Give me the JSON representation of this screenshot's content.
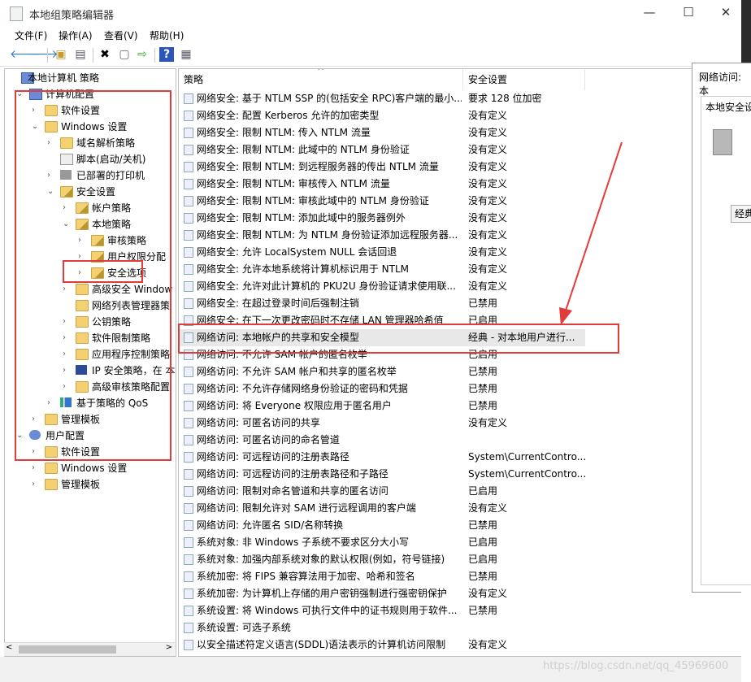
{
  "window": {
    "title": "本地组策略编辑器",
    "minimize": "—",
    "maximize": "☐",
    "close": "✕"
  },
  "menu": [
    "文件(F)",
    "操作(A)",
    "查看(V)",
    "帮助(H)"
  ],
  "tree": [
    {
      "label": "本地计算机 策略",
      "level": 0,
      "arrow": "",
      "icon": "computer-icon"
    },
    {
      "label": "计算机配置",
      "level": 1,
      "arrow": "v",
      "icon": "computer-icon"
    },
    {
      "label": "软件设置",
      "level": 2,
      "arrow": ">",
      "icon": "folder-icon"
    },
    {
      "label": "Windows 设置",
      "level": 2,
      "arrow": "v",
      "icon": "folder-icon"
    },
    {
      "label": "域名解析策略",
      "level": 3,
      "arrow": ">",
      "icon": "folder-icon"
    },
    {
      "label": "脚本(启动/关机)",
      "level": 3,
      "arrow": "",
      "icon": "script-icon"
    },
    {
      "label": "已部署的打印机",
      "level": 3,
      "arrow": ">",
      "icon": "printer-icon"
    },
    {
      "label": "安全设置",
      "level": 3,
      "arrow": "v",
      "icon": "security-folder-icon"
    },
    {
      "label": "帐户策略",
      "level": 4,
      "arrow": ">",
      "icon": "security-folder-icon"
    },
    {
      "label": "本地策略",
      "level": 4,
      "arrow": "v",
      "icon": "security-folder-icon"
    },
    {
      "label": "审核策略",
      "level": 5,
      "arrow": ">",
      "icon": "security-folder-icon"
    },
    {
      "label": "用户权限分配",
      "level": 5,
      "arrow": ">",
      "icon": "security-folder-icon"
    },
    {
      "label": "安全选项",
      "level": 5,
      "arrow": ">",
      "icon": "security-folder-icon"
    },
    {
      "label": "高级安全 Window",
      "level": 4,
      "arrow": ">",
      "icon": "folder-icon"
    },
    {
      "label": "网络列表管理器策",
      "level": 4,
      "arrow": "",
      "icon": "folder-icon"
    },
    {
      "label": "公钥策略",
      "level": 4,
      "arrow": ">",
      "icon": "folder-icon"
    },
    {
      "label": "软件限制策略",
      "level": 4,
      "arrow": ">",
      "icon": "folder-icon"
    },
    {
      "label": "应用程序控制策略",
      "level": 4,
      "arrow": ">",
      "icon": "folder-icon"
    },
    {
      "label": "IP 安全策略，在 本",
      "level": 4,
      "arrow": ">",
      "icon": "ipsec-icon"
    },
    {
      "label": "高级审核策略配置",
      "level": 4,
      "arrow": ">",
      "icon": "folder-icon"
    },
    {
      "label": "基于策略的 QoS",
      "level": 3,
      "arrow": ">",
      "icon": "chart-icon"
    },
    {
      "label": "管理模板",
      "level": 2,
      "arrow": ">",
      "icon": "folder-icon"
    },
    {
      "label": "用户配置",
      "level": 1,
      "arrow": "v",
      "icon": "user-icon"
    },
    {
      "label": "软件设置",
      "level": 2,
      "arrow": ">",
      "icon": "folder-icon"
    },
    {
      "label": "Windows 设置",
      "level": 2,
      "arrow": ">",
      "icon": "folder-icon"
    },
    {
      "label": "管理模板",
      "level": 2,
      "arrow": ">",
      "icon": "folder-icon"
    }
  ],
  "columns": {
    "policy": "策略",
    "setting": "安全设置"
  },
  "rows": [
    {
      "name": "网络安全: 基于 NTLM SSP 的(包括安全 RPC)客户端的最小...",
      "value": "要求 128 位加密"
    },
    {
      "name": "网络安全: 配置 Kerberos 允许的加密类型",
      "value": "没有定义"
    },
    {
      "name": "网络安全: 限制 NTLM: 传入 NTLM 流量",
      "value": "没有定义"
    },
    {
      "name": "网络安全: 限制 NTLM: 此域中的 NTLM 身份验证",
      "value": "没有定义"
    },
    {
      "name": "网络安全: 限制 NTLM: 到远程服务器的传出 NTLM 流量",
      "value": "没有定义"
    },
    {
      "name": "网络安全: 限制 NTLM: 审核传入 NTLM 流量",
      "value": "没有定义"
    },
    {
      "name": "网络安全: 限制 NTLM: 审核此域中的 NTLM 身份验证",
      "value": "没有定义"
    },
    {
      "name": "网络安全: 限制 NTLM: 添加此域中的服务器例外",
      "value": "没有定义"
    },
    {
      "name": "网络安全: 限制 NTLM: 为 NTLM 身份验证添加远程服务器...",
      "value": "没有定义"
    },
    {
      "name": "网络安全: 允许 LocalSystem NULL 会话回退",
      "value": "没有定义"
    },
    {
      "name": "网络安全: 允许本地系统将计算机标识用于 NTLM",
      "value": "没有定义"
    },
    {
      "name": "网络安全: 允许对此计算机的 PKU2U 身份验证请求使用联...",
      "value": "没有定义"
    },
    {
      "name": "网络安全: 在超过登录时间后强制注销",
      "value": "已禁用"
    },
    {
      "name": "网络安全: 在下一次更改密码时不存储 LAN 管理器哈希值",
      "value": "已启用"
    },
    {
      "name": "网络访问: 本地帐户的共享和安全模型",
      "value": "经典 - 对本地用户进行..."
    },
    {
      "name": "网络访问: 不允许 SAM 帐户的匿名枚举",
      "value": "已启用"
    },
    {
      "name": "网络访问: 不允许 SAM 帐户和共享的匿名枚举",
      "value": "已禁用"
    },
    {
      "name": "网络访问: 不允许存储网络身份验证的密码和凭据",
      "value": "已禁用"
    },
    {
      "name": "网络访问: 将 Everyone 权限应用于匿名用户",
      "value": "已禁用"
    },
    {
      "name": "网络访问: 可匿名访问的共享",
      "value": "没有定义"
    },
    {
      "name": "网络访问: 可匿名访问的命名管道",
      "value": ""
    },
    {
      "name": "网络访问: 可远程访问的注册表路径",
      "value": "System\\CurrentContro..."
    },
    {
      "name": "网络访问: 可远程访问的注册表路径和子路径",
      "value": "System\\CurrentContro..."
    },
    {
      "name": "网络访问: 限制对命名管道和共享的匿名访问",
      "value": "已启用"
    },
    {
      "name": "网络访问: 限制允许对 SAM 进行远程调用的客户端",
      "value": "没有定义"
    },
    {
      "name": "网络访问: 允许匿名 SID/名称转换",
      "value": "已禁用"
    },
    {
      "name": "系统对象: 非 Windows 子系统不要求区分大小写",
      "value": "已启用"
    },
    {
      "name": "系统对象: 加强内部系统对象的默认权限(例如，符号链接)",
      "value": "已启用"
    },
    {
      "name": "系统加密: 将 FIPS 兼容算法用于加密、哈希和签名",
      "value": "已禁用"
    },
    {
      "name": "系统加密: 为计算机上存储的用户密钥强制进行强密钥保护",
      "value": "没有定义"
    },
    {
      "name": "系统设置: 将 Windows 可执行文件中的证书规则用于软件...",
      "value": "已禁用"
    },
    {
      "name": "系统设置: 可选子系统",
      "value": ""
    },
    {
      "name": "以安全描述符定义语言(SDDL)语法表示的计算机访问限制",
      "value": "没有定义"
    }
  ],
  "side_window": {
    "title": "网络访问: 本",
    "tab": "本地安全设",
    "button": "经典"
  },
  "watermark": "https://blog.csdn.net/qq_45969600",
  "colors": {
    "annotation": "#e23b3b",
    "selection": "#e8e8e8"
  }
}
